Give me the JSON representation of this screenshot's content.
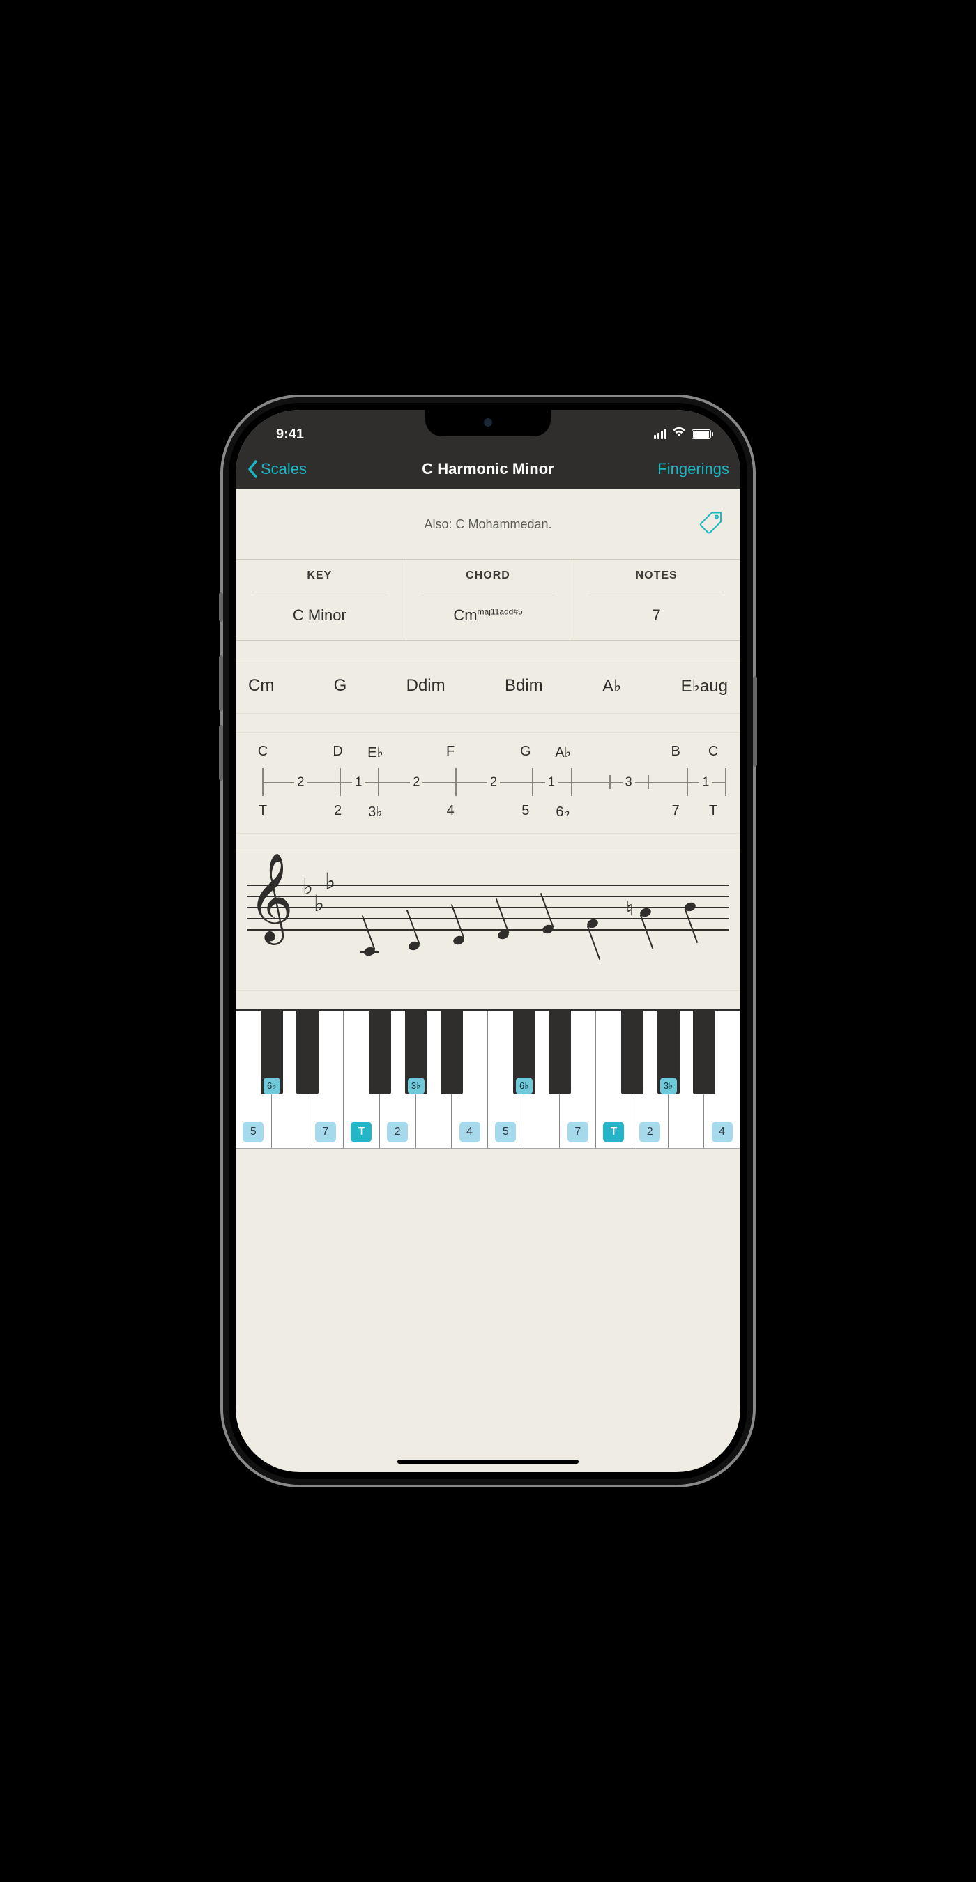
{
  "status": {
    "time": "9:41"
  },
  "nav": {
    "back": "Scales",
    "title": "C Harmonic Minor",
    "right": "Fingerings"
  },
  "aka": "Also: C Mohammedan.",
  "table": {
    "headers": [
      "KEY",
      "CHORD",
      "NOTES"
    ],
    "key": "C Minor",
    "chord_base": "Cm",
    "chord_sup": "maj11add#5",
    "notes": "7"
  },
  "chords": [
    "Cm",
    "G",
    "Ddim",
    "Bdim",
    "A♭",
    "E♭aug"
  ],
  "intervals": {
    "notes": [
      "C",
      "",
      "D",
      "E♭",
      "",
      "F",
      "",
      "G",
      "A♭",
      "",
      "",
      "B",
      "C"
    ],
    "degrees": [
      "T",
      "",
      "2",
      "3♭",
      "",
      "4",
      "",
      "5",
      "6♭",
      "",
      "",
      "7",
      "T"
    ],
    "steps": [
      "2",
      "1",
      "2",
      "2",
      "1",
      "3",
      "1"
    ]
  },
  "keyboard": {
    "whites": [
      {
        "deg": "5"
      },
      {
        "deg": ""
      },
      {
        "deg": "7"
      },
      {
        "deg": "T",
        "tonic": true
      },
      {
        "deg": "2"
      },
      {
        "deg": ""
      },
      {
        "deg": "4"
      },
      {
        "deg": "5"
      },
      {
        "deg": ""
      },
      {
        "deg": "7"
      },
      {
        "deg": "T",
        "tonic": true
      },
      {
        "deg": "2"
      },
      {
        "deg": ""
      },
      {
        "deg": "4"
      }
    ],
    "blacks": [
      {
        "after": 0,
        "deg": "6♭"
      },
      {
        "after": 1,
        "deg": ""
      },
      {
        "after": 3,
        "deg": ""
      },
      {
        "after": 4,
        "deg": "3♭"
      },
      {
        "after": 5,
        "deg": ""
      },
      {
        "after": 7,
        "deg": "6♭"
      },
      {
        "after": 8,
        "deg": ""
      },
      {
        "after": 10,
        "deg": ""
      },
      {
        "after": 11,
        "deg": "3♭"
      },
      {
        "after": 12,
        "deg": ""
      }
    ]
  }
}
